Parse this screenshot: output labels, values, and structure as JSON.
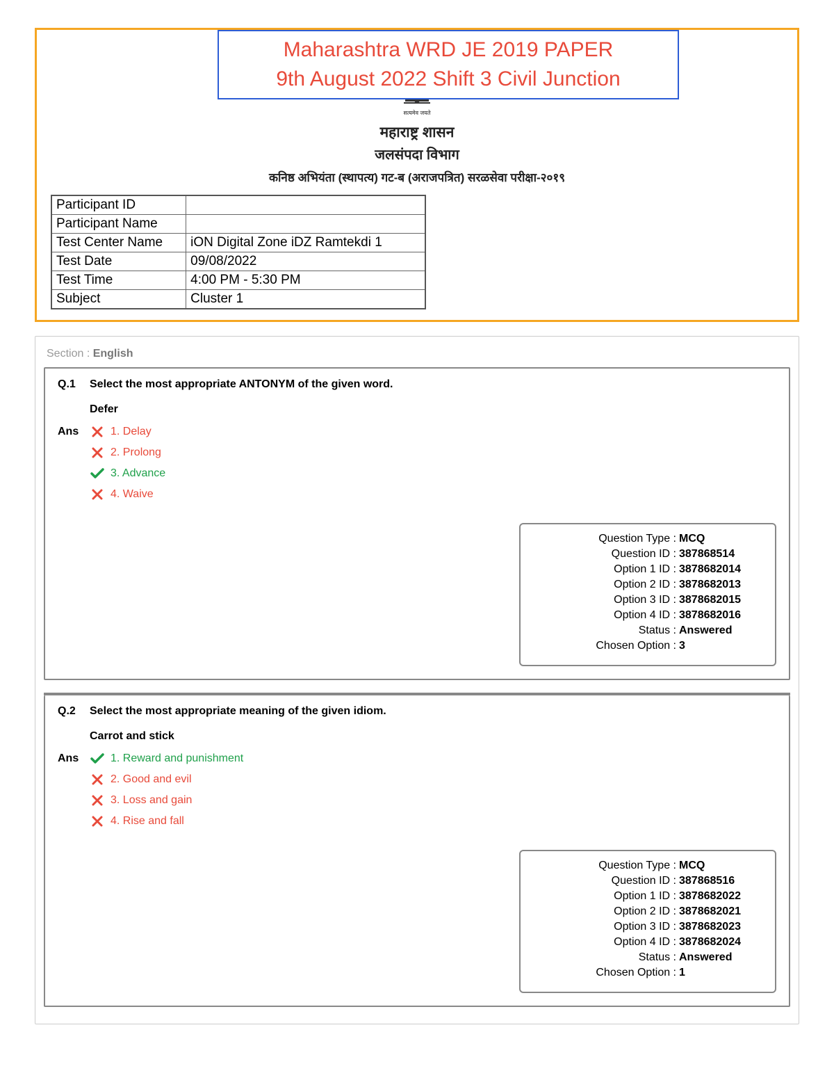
{
  "header": {
    "title_line1": "Maharashtra WRD JE 2019 PAPER",
    "title_line2": "9th August 2022 Shift 3 Civil Junction",
    "hindi_line1": "महाराष्ट्र शासन",
    "hindi_line2": "जलसंपदा विभाग",
    "hindi_line3": "कनिष्ठ अभियंता (स्थापत्य) गट-ब (अराजपत्रित) सरळसेवा परीक्षा-२०१९"
  },
  "info": {
    "rows": [
      {
        "label": "Participant ID",
        "value": ""
      },
      {
        "label": "Participant Name",
        "value": ""
      },
      {
        "label": "Test Center Name",
        "value": "iON Digital Zone iDZ Ramtekdi 1"
      },
      {
        "label": "Test Date",
        "value": "09/08/2022"
      },
      {
        "label": "Test Time",
        "value": "4:00 PM - 5:30 PM"
      },
      {
        "label": "Subject",
        "value": "Cluster 1"
      }
    ]
  },
  "section": {
    "prefix": "Section : ",
    "name": "English"
  },
  "questions": [
    {
      "num": "Q.1",
      "text": "Select the most appropriate ANTONYM of the given word.",
      "word": "Defer",
      "ans_label": "Ans",
      "options": [
        {
          "text": "1. Delay",
          "correct": false
        },
        {
          "text": "2. Prolong",
          "correct": false
        },
        {
          "text": "3. Advance",
          "correct": true
        },
        {
          "text": "4. Waive",
          "correct": false
        }
      ],
      "meta": [
        {
          "k": "Question Type :",
          "v": "MCQ"
        },
        {
          "k": "Question ID :",
          "v": "387868514"
        },
        {
          "k": "Option 1 ID :",
          "v": "3878682014"
        },
        {
          "k": "Option 2 ID :",
          "v": "3878682013"
        },
        {
          "k": "Option 3 ID :",
          "v": "3878682015"
        },
        {
          "k": "Option 4 ID :",
          "v": "3878682016"
        },
        {
          "k": "Status :",
          "v": "Answered"
        },
        {
          "k": "Chosen Option :",
          "v": "3"
        }
      ]
    },
    {
      "num": "Q.2",
      "text": "Select the most appropriate meaning of the given idiom.",
      "word": "Carrot and stick",
      "ans_label": "Ans",
      "options": [
        {
          "text": "1. Reward and punishment",
          "correct": true
        },
        {
          "text": "2. Good and evil",
          "correct": false
        },
        {
          "text": "3. Loss and gain",
          "correct": false
        },
        {
          "text": "4. Rise and fall",
          "correct": false
        }
      ],
      "meta": [
        {
          "k": "Question Type :",
          "v": "MCQ"
        },
        {
          "k": "Question ID :",
          "v": "387868516"
        },
        {
          "k": "Option 1 ID :",
          "v": "3878682022"
        },
        {
          "k": "Option 2 ID :",
          "v": "3878682021"
        },
        {
          "k": "Option 3 ID :",
          "v": "3878682023"
        },
        {
          "k": "Option 4 ID :",
          "v": "3878682024"
        },
        {
          "k": "Status :",
          "v": "Answered"
        },
        {
          "k": "Chosen Option :",
          "v": "1"
        }
      ]
    }
  ]
}
